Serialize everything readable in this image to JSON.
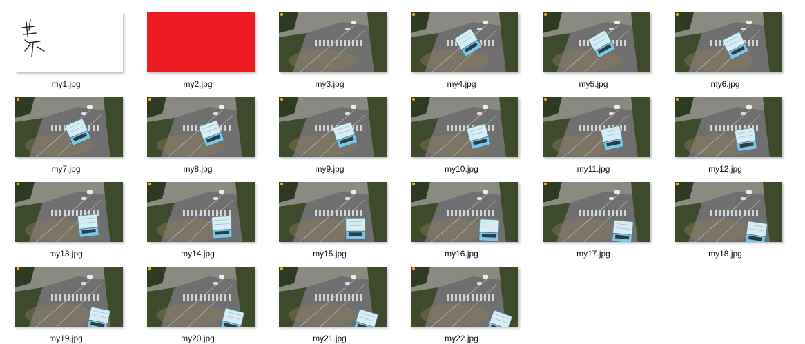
{
  "files": [
    {
      "name": "my1.jpg",
      "kind": "sketch",
      "truck": null
    },
    {
      "name": "my2.jpg",
      "kind": "solid",
      "color": "#ed1c24",
      "truck": null
    },
    {
      "name": "my3.jpg",
      "kind": "photo",
      "truck": null
    },
    {
      "name": "my4.jpg",
      "kind": "photo",
      "truck": 1
    },
    {
      "name": "my5.jpg",
      "kind": "photo",
      "truck": 2
    },
    {
      "name": "my6.jpg",
      "kind": "photo",
      "truck": 3
    },
    {
      "name": "my7.jpg",
      "kind": "photo",
      "truck": 4
    },
    {
      "name": "my8.jpg",
      "kind": "photo",
      "truck": 5
    },
    {
      "name": "my9.jpg",
      "kind": "photo",
      "truck": 6
    },
    {
      "name": "my10.jpg",
      "kind": "photo",
      "truck": 7
    },
    {
      "name": "my11.jpg",
      "kind": "photo",
      "truck": 8
    },
    {
      "name": "my12.jpg",
      "kind": "photo",
      "truck": 9
    },
    {
      "name": "my13.jpg",
      "kind": "photo",
      "truck": 10
    },
    {
      "name": "my14.jpg",
      "kind": "photo",
      "truck": 11
    },
    {
      "name": "my15.jpg",
      "kind": "photo",
      "truck": 12
    },
    {
      "name": "my16.jpg",
      "kind": "photo",
      "truck": 13
    },
    {
      "name": "my17.jpg",
      "kind": "photo",
      "truck": 14
    },
    {
      "name": "my18.jpg",
      "kind": "photo",
      "truck": 15
    },
    {
      "name": "my19.jpg",
      "kind": "photo",
      "truck": 16
    },
    {
      "name": "my20.jpg",
      "kind": "photo",
      "truck": 17
    },
    {
      "name": "my21.jpg",
      "kind": "photo",
      "truck": 18
    },
    {
      "name": "my22.jpg",
      "kind": "photo",
      "truck": 19
    }
  ],
  "colors": {
    "road": "#6f6f6f",
    "trees": "#3d4a2c",
    "truck": "#7fc6e4",
    "truck_roof": "#d8ecf4",
    "crosswalk": "#e6e6e6"
  }
}
